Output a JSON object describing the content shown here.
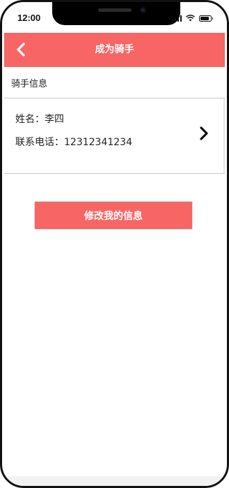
{
  "status_bar": {
    "time": "12:00"
  },
  "header": {
    "title": "成为骑手",
    "back_icon": "chevron-left-icon",
    "background_color": "#f76664"
  },
  "section": {
    "label": "骑手信息"
  },
  "rider_info": {
    "name_line": "姓名：李四",
    "phone_line": "联系电话：12312341234",
    "chevron_icon": "chevron-right-icon"
  },
  "actions": {
    "edit_label": "修改我的信息",
    "accent_color": "#f76664"
  }
}
